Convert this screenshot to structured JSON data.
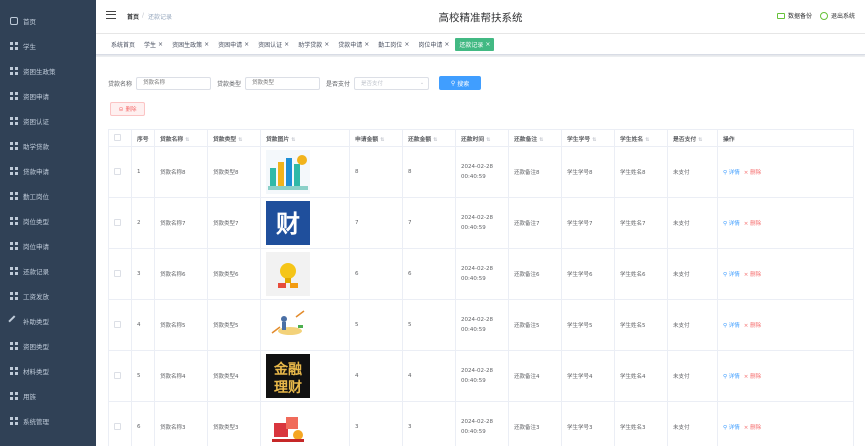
{
  "sidebar": {
    "items": [
      {
        "label": "首页",
        "icon": "home-icon"
      },
      {
        "label": "学生",
        "icon": "grid-icon"
      },
      {
        "label": "资困生政策",
        "icon": "grid-icon"
      },
      {
        "label": "资困申请",
        "icon": "grid-icon"
      },
      {
        "label": "资困认证",
        "icon": "grid-icon"
      },
      {
        "label": "助学贷款",
        "icon": "grid-icon"
      },
      {
        "label": "贷款申请",
        "icon": "grid-icon"
      },
      {
        "label": "勤工岗位",
        "icon": "grid-icon"
      },
      {
        "label": "岗位类型",
        "icon": "grid-icon"
      },
      {
        "label": "岗位申请",
        "icon": "grid-icon"
      },
      {
        "label": "还款记录",
        "icon": "grid-icon"
      },
      {
        "label": "工资发放",
        "icon": "grid-icon"
      },
      {
        "label": "补助类型",
        "icon": "tool-icon"
      },
      {
        "label": "资困类型",
        "icon": "grid-icon"
      },
      {
        "label": "材料类型",
        "icon": "grid-icon"
      },
      {
        "label": "用族",
        "icon": "grid-icon"
      },
      {
        "label": "系统管理",
        "icon": "grid-icon"
      }
    ]
  },
  "header": {
    "breadcrumb_home": "首页",
    "breadcrumb_sep": "/",
    "breadcrumb_current": "还款记录",
    "title": "高校精准帮扶系统",
    "backup_label": "数据备份",
    "logout_label": "退出系统"
  },
  "tags": [
    {
      "label": "系统首页",
      "closable": false,
      "active": false
    },
    {
      "label": "学生",
      "closable": true,
      "active": false
    },
    {
      "label": "资困生政策",
      "closable": true,
      "active": false
    },
    {
      "label": "资困申请",
      "closable": true,
      "active": false
    },
    {
      "label": "资困认证",
      "closable": true,
      "active": false
    },
    {
      "label": "助学贷款",
      "closable": true,
      "active": false
    },
    {
      "label": "贷款申请",
      "closable": true,
      "active": false
    },
    {
      "label": "勤工岗位",
      "closable": true,
      "active": false
    },
    {
      "label": "岗位申请",
      "closable": true,
      "active": false
    },
    {
      "label": "还款记录",
      "closable": true,
      "active": true
    }
  ],
  "search": {
    "name_label": "贷款名称",
    "name_placeholder": "贷款名称",
    "type_label": "贷款类型",
    "type_placeholder": "贷款类型",
    "paid_label": "是否支付",
    "paid_placeholder": "是否支付",
    "search_button": "搜索"
  },
  "delete_button": "删除",
  "table": {
    "columns": [
      "序号",
      "贷款名称",
      "贷款类型",
      "贷款图片",
      "申请金额",
      "还款金额",
      "还款时间",
      "还款备注",
      "学生学号",
      "学生姓名",
      "是否支付",
      "操作"
    ],
    "detail_label": "详情",
    "delete_label": "删除",
    "rows": [
      {
        "index": "1",
        "name": "贷款名称8",
        "type": "贷款类型8",
        "image": "finance-illustration",
        "apply": "8",
        "repay": "8",
        "time": "2024-02-28 00:40:59",
        "remark": "还款备注8",
        "sno": "学生学号8",
        "sname": "学生姓名8",
        "paid": "未支付"
      },
      {
        "index": "2",
        "name": "贷款名称7",
        "type": "贷款类型7",
        "image": "cai-logo",
        "cai_text": "财",
        "apply": "7",
        "repay": "7",
        "time": "2024-02-28 00:40:59",
        "remark": "还款备注7",
        "sno": "学生学号7",
        "sname": "学生姓名7",
        "paid": "未支付"
      },
      {
        "index": "3",
        "name": "贷款名称6",
        "type": "贷款类型6",
        "image": "bulb-illustration",
        "apply": "6",
        "repay": "6",
        "time": "2024-02-28 00:40:59",
        "remark": "还款备注6",
        "sno": "学生学号6",
        "sname": "学生姓名6",
        "paid": "未支付"
      },
      {
        "index": "4",
        "name": "贷款名称5",
        "type": "贷款类型5",
        "image": "money-flow-illustration",
        "apply": "5",
        "repay": "5",
        "time": "2024-02-28 00:40:59",
        "remark": "还款备注5",
        "sno": "学生学号5",
        "sname": "学生姓名5",
        "paid": "未支付"
      },
      {
        "index": "5",
        "name": "贷款名称4",
        "type": "贷款类型4",
        "image": "jinrong-licai-logo",
        "jr_text": "金融",
        "lc_text": "理财",
        "apply": "4",
        "repay": "4",
        "time": "2024-02-28 00:40:59",
        "remark": "还款备注4",
        "sno": "学生学号4",
        "sname": "学生姓名4",
        "paid": "未支付"
      },
      {
        "index": "6",
        "name": "贷款名称3",
        "type": "贷款类型3",
        "image": "red-finance-illustration",
        "apply": "3",
        "repay": "3",
        "time": "2024-02-28 00:40:59",
        "remark": "还款备注3",
        "sno": "学生学号3",
        "sname": "学生姓名3",
        "paid": "未支付"
      }
    ]
  },
  "colors": {
    "sidebar": "#304156",
    "accent": "#409eff",
    "active_tag": "#42b983",
    "danger": "#f56c6c"
  }
}
